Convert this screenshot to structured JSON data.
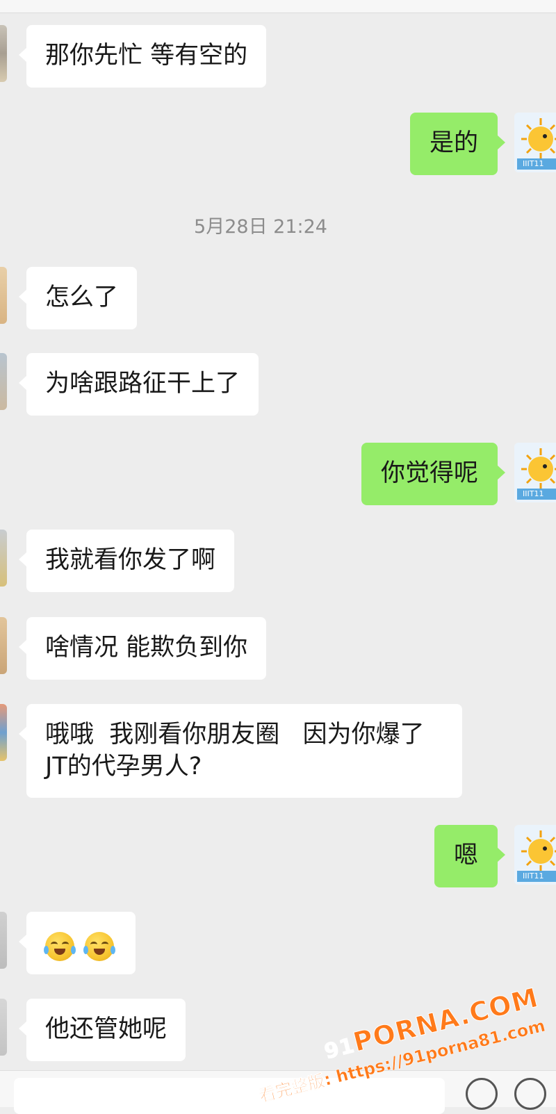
{
  "messages": [
    {
      "side": "left",
      "text": "那你先忙 等有空的"
    },
    {
      "side": "right",
      "text": "是的"
    },
    {
      "side": "left",
      "text": "怎么了"
    },
    {
      "side": "left",
      "text": "为啥跟路征干上了"
    },
    {
      "side": "right",
      "text": "你觉得呢"
    },
    {
      "side": "left",
      "text": "我就看你发了啊"
    },
    {
      "side": "left",
      "text": "啥情况 能欺负到你"
    },
    {
      "side": "left",
      "line1": "哦哦  我刚看你朋友圈   因为你爆了",
      "line2": "JT的代孕男人?"
    },
    {
      "side": "right",
      "text": "嗯"
    },
    {
      "side": "left",
      "emoji": "laughing-crying-emoji"
    },
    {
      "side": "left",
      "text": "他还管她呢"
    }
  ],
  "timestamp": "5月28日 21:24",
  "avatar_label": "IIIT11",
  "watermark": {
    "prefix": "91",
    "brand": "PORNA.COM",
    "sub": "看完整版: https://91porna81.com"
  },
  "colors": {
    "background": "#ededed",
    "bubble_left": "#ffffff",
    "bubble_right": "#95ec69",
    "watermark": "#ff7a1a"
  }
}
